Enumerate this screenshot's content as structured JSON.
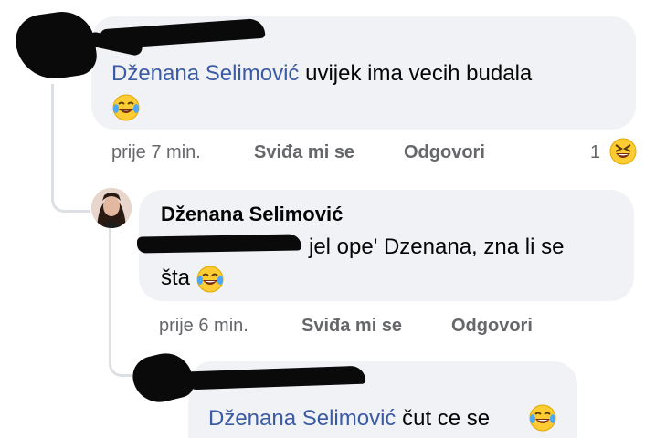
{
  "comments": [
    {
      "author_redacted": true,
      "mention": "Dženana Selimović",
      "text": "uvijek ima vecih budala",
      "emoji": "laughing-tears-emoji",
      "time": "prije 7 min.",
      "like_label": "Sviđa mi se",
      "reply_label": "Odgovori",
      "reaction_count": "1",
      "reaction_emoji": "laughing-squint-emoji"
    },
    {
      "author": "Dženana Selimović",
      "mention_redacted": true,
      "text": "jel ope' Dzenana, zna li se",
      "text_line2": "šta",
      "emoji": "laughing-tears-emoji",
      "time": "prije 6 min.",
      "like_label": "Sviđa mi se",
      "reply_label": "Odgovori"
    },
    {
      "author_redacted": true,
      "mention": "Dženana Selimović",
      "text": "čut ce se",
      "emoji": "laughing-tears-emoji"
    }
  ],
  "colors": {
    "bubble": "#f0f2f5",
    "mention": "#3b5ba5",
    "meta": "#65676b",
    "emoji_face": "#ffcc33"
  }
}
